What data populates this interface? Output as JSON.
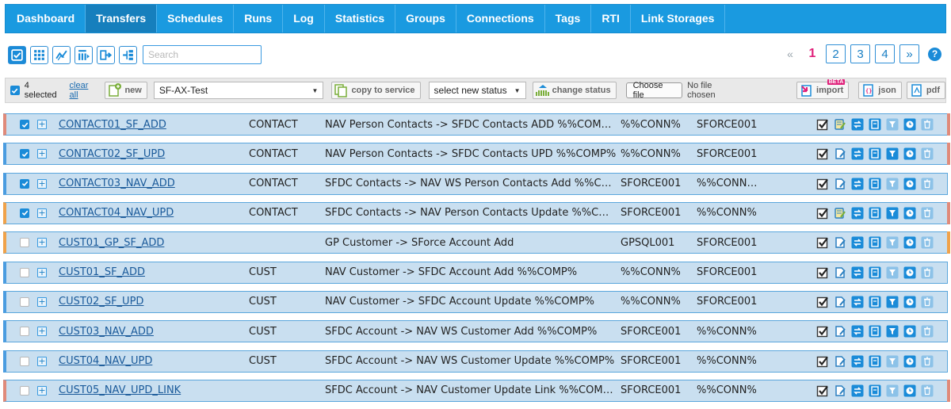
{
  "nav": {
    "items": [
      {
        "label": "Dashboard"
      },
      {
        "label": "Transfers",
        "active": true
      },
      {
        "label": "Schedules"
      },
      {
        "label": "Runs"
      },
      {
        "label": "Log"
      },
      {
        "label": "Statistics"
      },
      {
        "label": "Groups"
      },
      {
        "label": "Connections"
      },
      {
        "label": "Tags"
      },
      {
        "label": "RTI"
      },
      {
        "label": "Link Storages"
      }
    ]
  },
  "toolbar": {
    "search_placeholder": "Search"
  },
  "pager": {
    "prev": "«",
    "current": "1",
    "pages": [
      "2",
      "3",
      "4"
    ],
    "next": "»",
    "help": "?"
  },
  "actionbar": {
    "selected_text": "4 selected",
    "clear_all": "clear all",
    "new_label": "new",
    "service_select": "SF-AX-Test",
    "copy_label": "copy to service",
    "status_select": "select new status",
    "change_status_label": "change status",
    "choose_file": "Choose file",
    "no_file": "No file chosen",
    "import_label": "import",
    "beta": "BETA",
    "json_label": "json",
    "pdf_label": "pdf"
  },
  "colors": {
    "nav": "#1a9ae0",
    "nav_active": "#167fbd",
    "row_bg": "#c9dff0",
    "accent_pink": "#e0207a"
  },
  "rows": [
    {
      "checked": true,
      "name": "CONTACT01_SF_ADD",
      "group": "CONTACT",
      "description": "NAV Person Contacts -> SFDC Contacts ADD %%COMP%",
      "source": "%%CONN%",
      "target": "SFORCE001",
      "left": "red",
      "right": "red"
    },
    {
      "checked": true,
      "name": "CONTACT02_SF_UPD",
      "group": "CONTACT",
      "description": "NAV Person Contacts -> SFDC Contacts UPD %%COMP%",
      "source": "%%CONN%",
      "target": "SFORCE001",
      "left": "blue",
      "right": "red"
    },
    {
      "checked": true,
      "name": "CONTACT03_NAV_ADD",
      "group": "CONTACT",
      "description": "SFDC Contacts -> NAV WS Person Contacts Add %%COMP%",
      "source": "SFORCE001",
      "target": "%%CONNWS%",
      "left": "blue",
      "right": "none"
    },
    {
      "checked": true,
      "name": "CONTACT04_NAV_UPD",
      "group": "CONTACT",
      "description": "SFDC Contacts -> NAV Person Contacts Update %%COMP%",
      "source": "SFORCE001",
      "target": "%%CONN%",
      "left": "orange",
      "right": "red"
    },
    {
      "checked": false,
      "name": "CUST01_GP_SF_ADD",
      "group": "",
      "description": "GP Customer -> SForce Account Add",
      "source": "GPSQL001",
      "target": "SFORCE001",
      "left": "orange",
      "right": "orange"
    },
    {
      "checked": false,
      "name": "CUST01_SF_ADD",
      "group": "CUST",
      "description": "NAV Customer -> SFDC Account Add %%COMP%",
      "source": "%%CONN%",
      "target": "SFORCE001",
      "left": "blue",
      "right": "none"
    },
    {
      "checked": false,
      "name": "CUST02_SF_UPD",
      "group": "CUST",
      "description": "NAV Customer -> SFDC Account Update %%COMP%",
      "source": "%%CONN%",
      "target": "SFORCE001",
      "left": "blue",
      "right": "none"
    },
    {
      "checked": false,
      "name": "CUST03_NAV_ADD",
      "group": "CUST",
      "description": "SFDC Account -> NAV WS Customer Add %%COMP%",
      "source": "SFORCE001",
      "target": "%%CONN%",
      "left": "blue",
      "right": "none"
    },
    {
      "checked": false,
      "name": "CUST04_NAV_UPD",
      "group": "CUST",
      "description": "SFDC Account -> NAV WS Customer Update %%COMP%",
      "source": "SFORCE001",
      "target": "%%CONN%",
      "left": "blue",
      "right": "none"
    },
    {
      "checked": false,
      "name": "CUST05_NAV_UPD_LINK",
      "group": "",
      "description": "SFDC Account -> NAV Customer Update Link %%COMP%",
      "source": "SFORCE001",
      "target": "%%CONN%",
      "left": "red",
      "right": "red"
    }
  ],
  "row_action_icons": [
    "enabled-check-icon",
    "edit-icon",
    "sync-icon",
    "detail-icon",
    "filter-icon",
    "clock-icon",
    "trash-icon"
  ]
}
